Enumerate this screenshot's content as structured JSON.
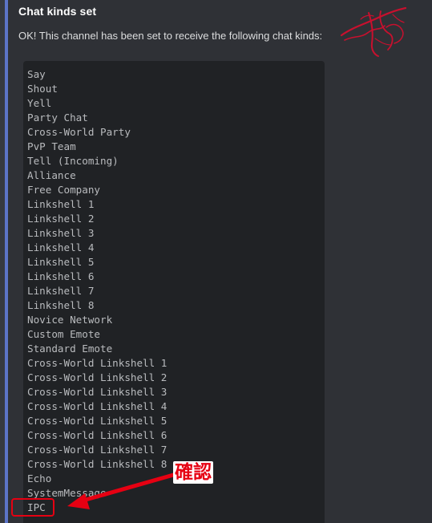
{
  "embed": {
    "title": "Chat kinds set",
    "description": "OK! This channel has been set to receive the following chat kinds:",
    "accent_color": "#5c74c7",
    "thumbnail_icon": "red-signature-logo"
  },
  "chat_kinds": [
    "Say",
    "Shout",
    "Yell",
    "Party Chat",
    "Cross-World Party",
    "PvP Team",
    "Tell (Incoming)",
    "Alliance",
    "Free Company",
    "Linkshell 1",
    "Linkshell 2",
    "Linkshell 3",
    "Linkshell 4",
    "Linkshell 5",
    "Linkshell 6",
    "Linkshell 7",
    "Linkshell 8",
    "Novice Network",
    "Custom Emote",
    "Standard Emote",
    "Cross-World Linkshell 1",
    "Cross-World Linkshell 2",
    "Cross-World Linkshell 3",
    "Cross-World Linkshell 4",
    "Cross-World Linkshell 5",
    "Cross-World Linkshell 6",
    "Cross-World Linkshell 7",
    "Cross-World Linkshell 8",
    "Echo",
    "SystemMessage",
    "IPC"
  ],
  "annotation": {
    "label": "確認",
    "color": "#e60012",
    "target_item": "IPC"
  }
}
